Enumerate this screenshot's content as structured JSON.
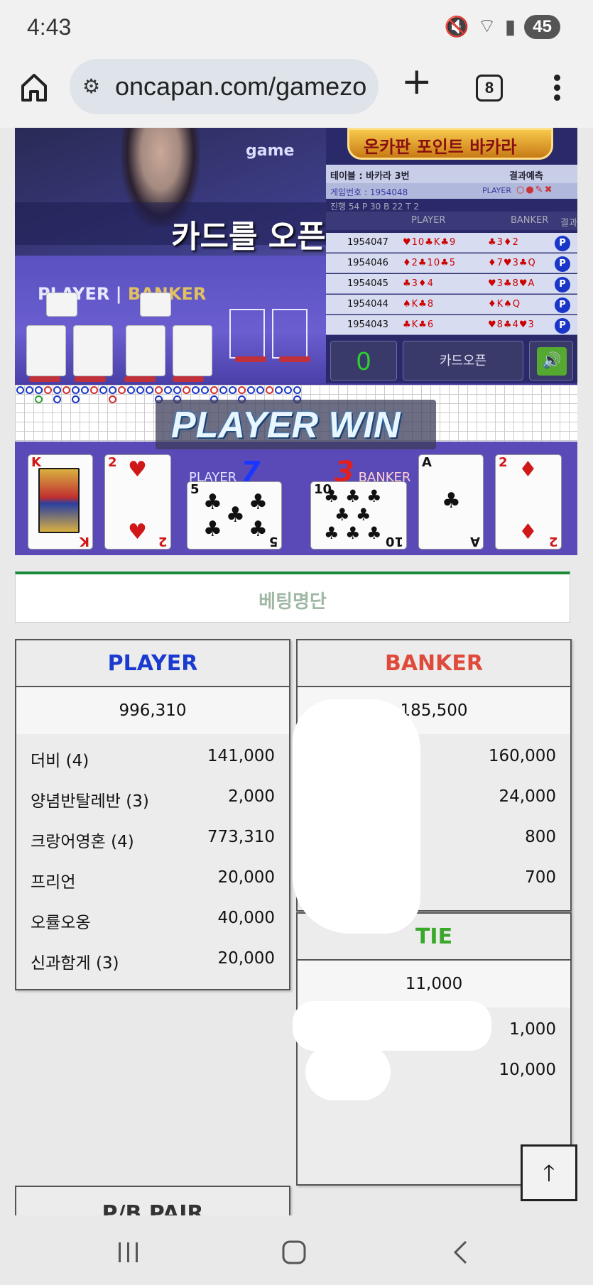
{
  "status_bar": {
    "time": "4:43",
    "battery": "45"
  },
  "browser": {
    "url": "oncapan.com/gamezo",
    "tab_count": "8"
  },
  "game": {
    "watermark": "game",
    "announcement": "카드를 오픈합니다.",
    "logo_text": "온카판 포인트 바카라",
    "player_label": "PLAYER",
    "banker_label": "BANKER",
    "info": {
      "table": "테이블 : 바카라 3번",
      "prediction": "결과예측",
      "game_no": "게임번호 : 1954048",
      "stats": "진행 54  P 30  B 22  T 2",
      "pred_player": "PLAYER",
      "col_player": "PLAYER",
      "col_banker": "BANKER",
      "col_result": "결과"
    },
    "history": [
      {
        "id": "1954047",
        "player": "♥10♣K♣9",
        "banker": "♣3♦2",
        "result": "P"
      },
      {
        "id": "1954046",
        "player": "♦2♣10♣5",
        "banker": "♦7♥3♣Q",
        "result": "P"
      },
      {
        "id": "1954045",
        "player": "♣3♦4",
        "banker": "♥3♣8♥A",
        "result": "P"
      },
      {
        "id": "1954044",
        "player": "♠K♣8",
        "banker": "♦K♠Q",
        "result": "P"
      },
      {
        "id": "1954043",
        "player": "♣K♣6",
        "banker": "♥8♣4♥3",
        "result": "P"
      }
    ],
    "score": "0",
    "open_button": "카드오픈",
    "win_text": "PLAYER WIN",
    "player_score": "7",
    "banker_score": "3",
    "cards": [
      {
        "rank": "K",
        "suit": "♥"
      },
      {
        "rank": "2",
        "suit": "♥"
      },
      {
        "rank": "5",
        "suit": "♣"
      },
      {
        "rank": "10",
        "suit": "♣"
      },
      {
        "rank": "A",
        "suit": "♣"
      },
      {
        "rank": "2",
        "suit": "♦"
      }
    ]
  },
  "betting": {
    "tab_label": "베팅명단",
    "player": {
      "title": "PLAYER",
      "total": "996,310",
      "rows": [
        {
          "name": "더비 (4)",
          "amount": "141,000"
        },
        {
          "name": "양념반탈레반 (3)",
          "amount": "2,000"
        },
        {
          "name": "크랑어영혼 (4)",
          "amount": "773,310"
        },
        {
          "name": "프리언",
          "amount": "20,000"
        },
        {
          "name": "오률오옹",
          "amount": "40,000"
        },
        {
          "name": "신과함게 (3)",
          "amount": "20,000"
        }
      ]
    },
    "banker": {
      "title": "BANKER",
      "total": "185,500",
      "rows": [
        {
          "name": "",
          "amount": "160,000"
        },
        {
          "name": "",
          "amount": "24,000"
        },
        {
          "name": "",
          "amount": "800"
        },
        {
          "name": "",
          "amount": "700"
        }
      ]
    },
    "tie": {
      "title": "TIE",
      "total": "11,000",
      "rows": [
        {
          "name": "",
          "amount": "1,000"
        },
        {
          "name": "",
          "amount": "10,000"
        }
      ]
    },
    "pb_pair_title": "P/B PAIR"
  },
  "colors": {
    "player_blue": "#1a3ad0",
    "banker_red": "#e04a3a",
    "tie_green": "#3aa82a"
  }
}
